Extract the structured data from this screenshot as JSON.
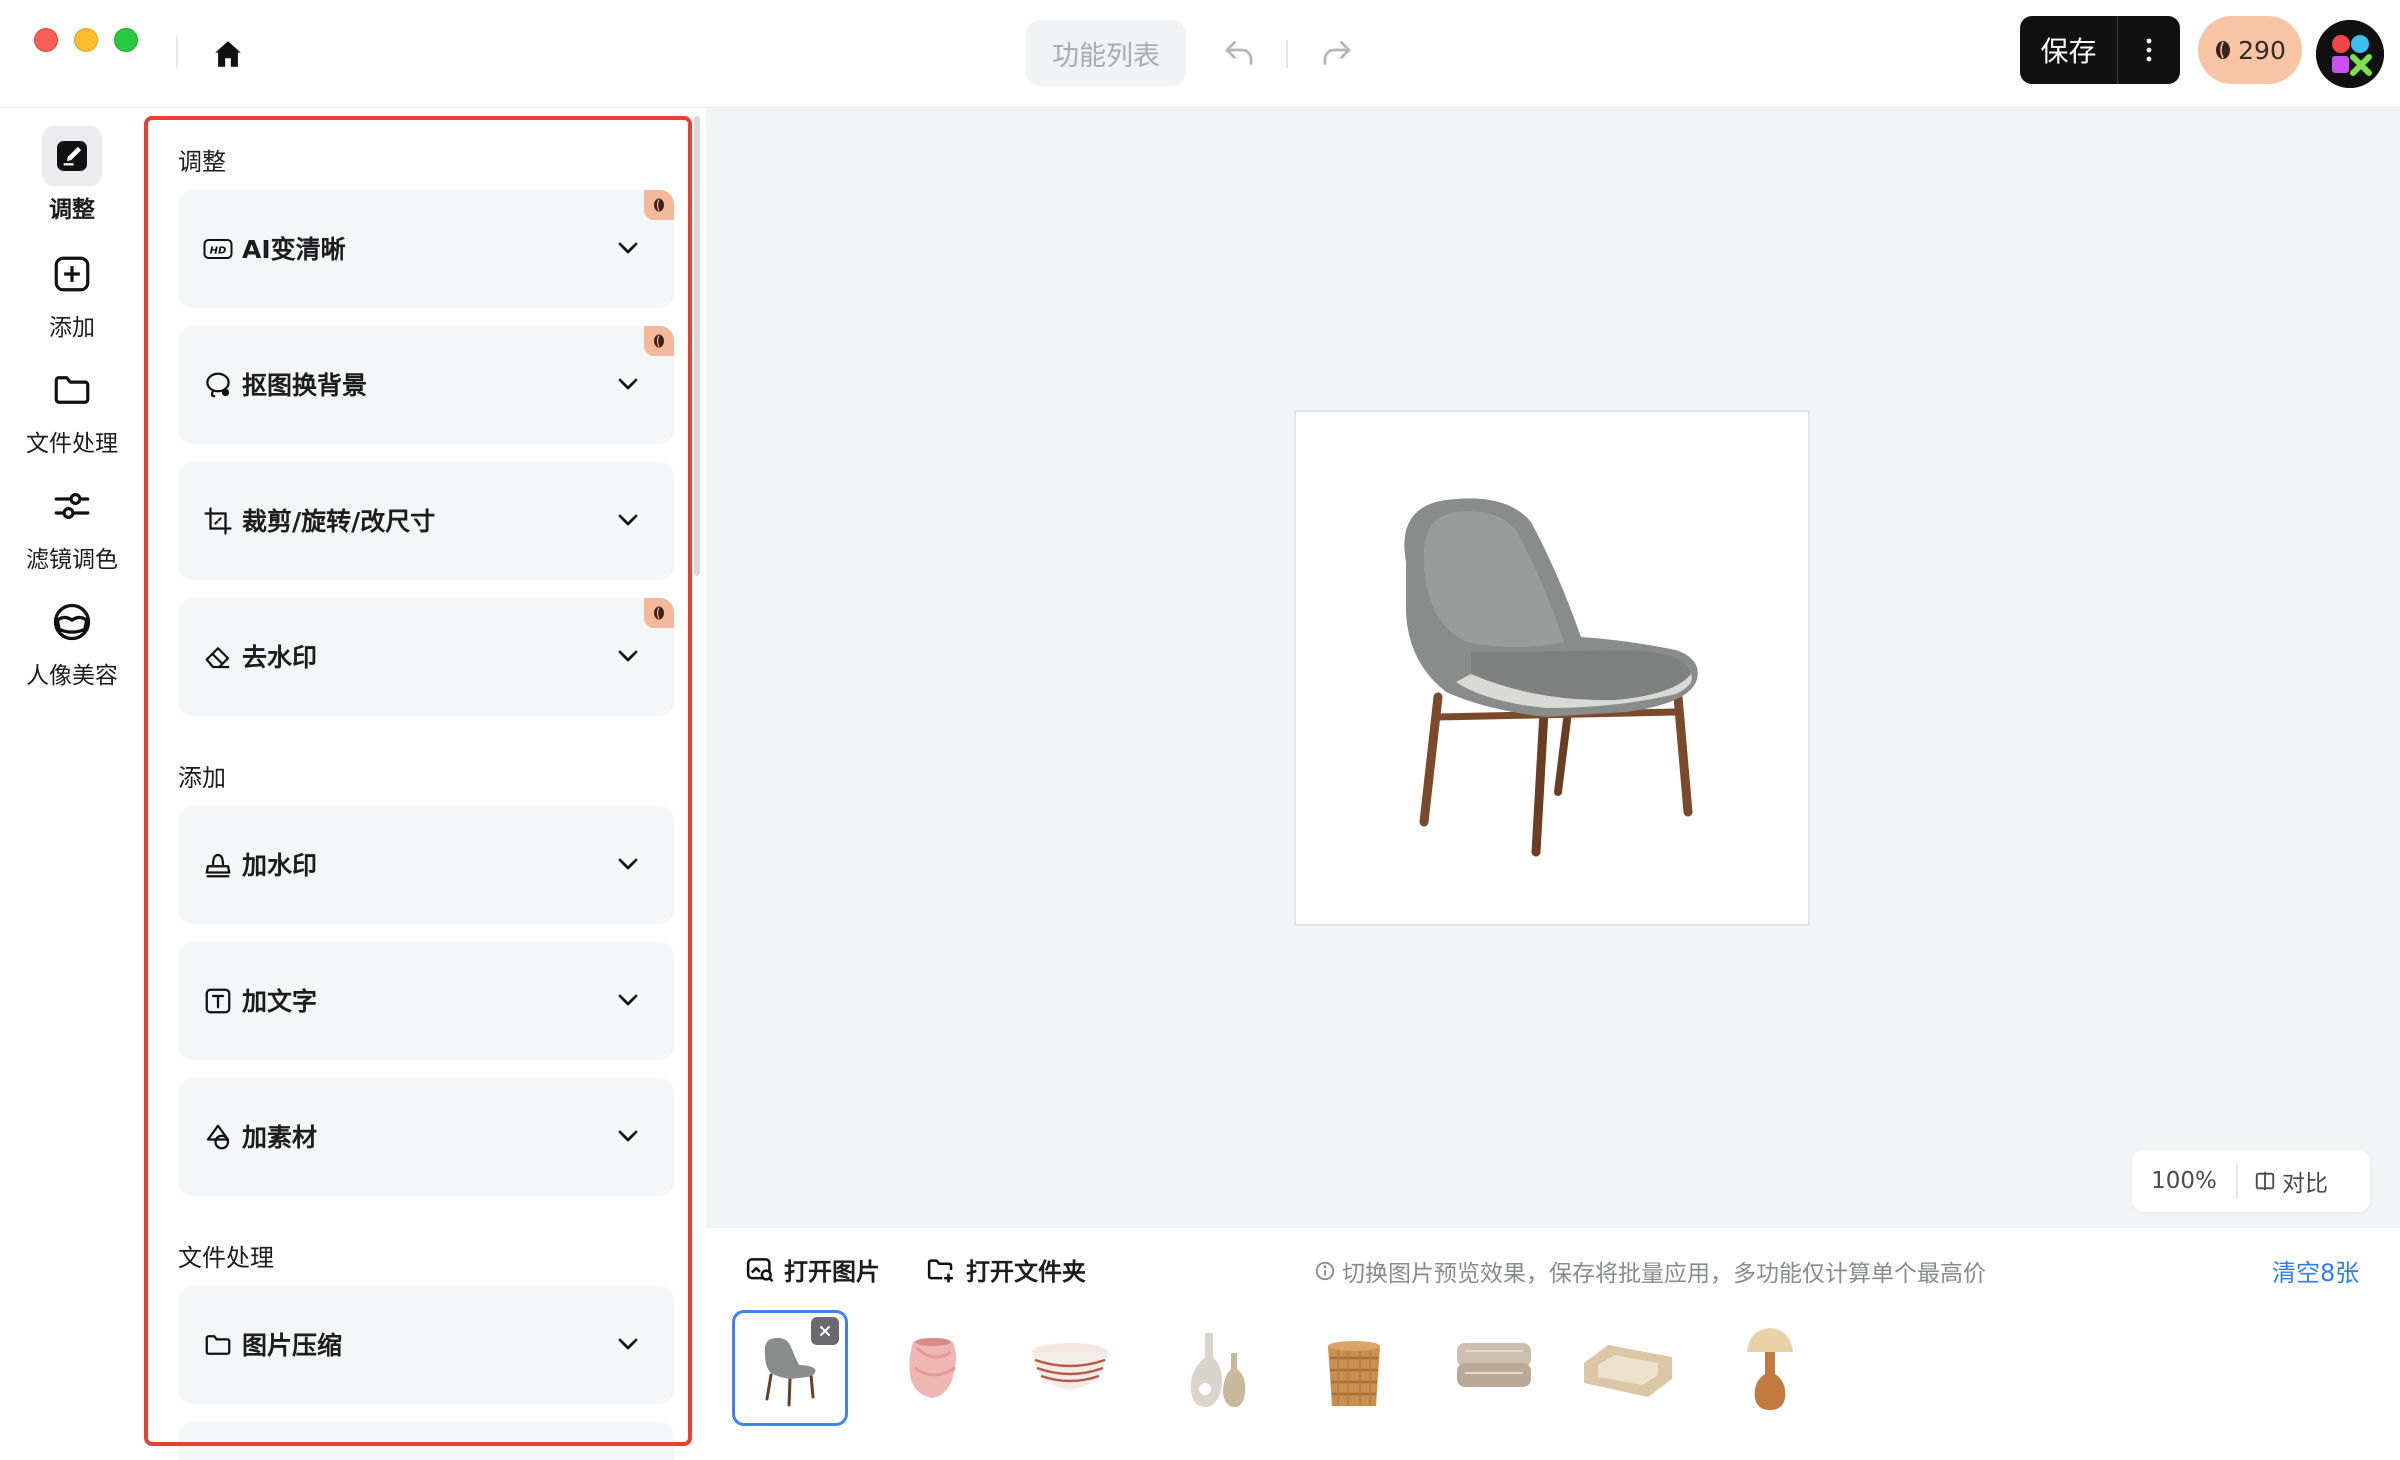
{
  "toolbar": {
    "function_list": "功能列表",
    "save_label": "保存",
    "credits": "290"
  },
  "rail": {
    "items": [
      {
        "label": "调整",
        "icon": "edit-icon",
        "active": true
      },
      {
        "label": "添加",
        "icon": "plus-square-icon"
      },
      {
        "label": "文件处理",
        "icon": "folder-icon"
      },
      {
        "label": "滤镜调色",
        "icon": "sliders-icon"
      },
      {
        "label": "人像美容",
        "icon": "face-mask-icon"
      }
    ]
  },
  "panel": {
    "sections": [
      {
        "title": "调整",
        "cards": [
          {
            "label": "AI变清晰",
            "icon": "hd-icon",
            "paid": true
          },
          {
            "label": "抠图换背景",
            "icon": "lasso-icon",
            "paid": true
          },
          {
            "label": "裁剪/旋转/改尺寸",
            "icon": "crop-icon",
            "paid": false
          },
          {
            "label": "去水印",
            "icon": "eraser-icon",
            "paid": true
          }
        ]
      },
      {
        "title": "添加",
        "cards": [
          {
            "label": "加水印",
            "icon": "stamp-icon",
            "paid": false
          },
          {
            "label": "加文字",
            "icon": "text-box-icon",
            "paid": false
          },
          {
            "label": "加素材",
            "icon": "shapes-icon",
            "paid": false
          }
        ]
      },
      {
        "title": "文件处理",
        "cards": [
          {
            "label": "图片压缩",
            "icon": "folder-icon",
            "paid": false
          }
        ]
      }
    ]
  },
  "canvas": {
    "zoom": "100%",
    "compare_label": "对比"
  },
  "filmstrip": {
    "open_image": "打开图片",
    "open_folder": "打开文件夹",
    "hint": "切换图片预览效果，保存将批量应用，多功能仅计算单个最高价",
    "clear": "清空8张",
    "thumbnails": [
      "chair",
      "pink-vase",
      "striped-bowl",
      "white-vases",
      "wicker-basket",
      "folded-blanket",
      "pet-bed",
      "table-lamp"
    ]
  },
  "colors": {
    "highlight": "#e8412f",
    "accent_blue": "#2f7ff0",
    "credit_bg": "#f7c5a6"
  }
}
